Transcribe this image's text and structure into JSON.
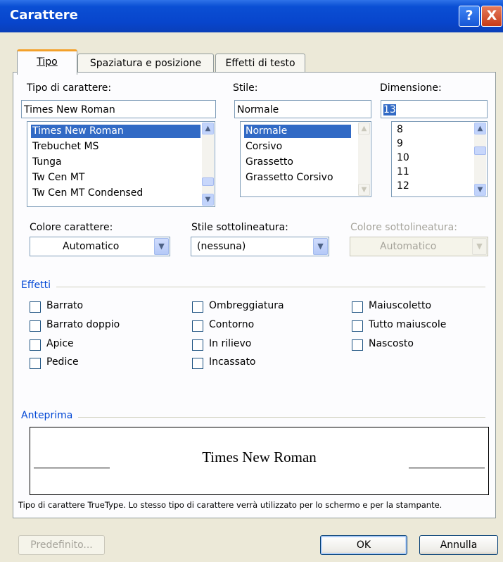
{
  "window": {
    "title": "Carattere",
    "help_label": "?",
    "close_label": "X"
  },
  "tabs": [
    "Tipo",
    "Spaziatura e posizione",
    "Effetti di testo"
  ],
  "font": {
    "label": "Tipo di carattere:",
    "value": "Times New Roman",
    "items": [
      "Times New Roman",
      "Trebuchet MS",
      "Tunga",
      "Tw Cen MT",
      "Tw Cen MT Condensed"
    ]
  },
  "style": {
    "label": "Stile:",
    "value": "Normale",
    "items": [
      "Normale",
      "Corsivo",
      "Grassetto",
      "Grassetto Corsivo"
    ]
  },
  "size": {
    "label": "Dimensione:",
    "value": "13",
    "items": [
      "8",
      "9",
      "10",
      "11",
      "12"
    ]
  },
  "font_color": {
    "label": "Colore carattere:",
    "value": "Automatico"
  },
  "underline_style": {
    "label": "Stile sottolineatura:",
    "value": "(nessuna)"
  },
  "underline_color": {
    "label": "Colore sottolineatura:",
    "value": "Automatico"
  },
  "effects": {
    "title": "Effetti",
    "col1": [
      "Barrato",
      "Barrato doppio",
      "Apice",
      "Pedice"
    ],
    "col2": [
      "Ombreggiatura",
      "Contorno",
      "In rilievo",
      "Incassato"
    ],
    "col3": [
      "Maiuscoletto",
      "Tutto maiuscole",
      "Nascosto"
    ]
  },
  "preview": {
    "title": "Anteprima",
    "sample": "Times New Roman",
    "note": "Tipo di carattere TrueType. Lo stesso tipo di carattere verrà utilizzato per lo schermo e per la stampante."
  },
  "buttons": {
    "default": "Predefinito...",
    "ok": "OK",
    "cancel": "Annulla"
  }
}
